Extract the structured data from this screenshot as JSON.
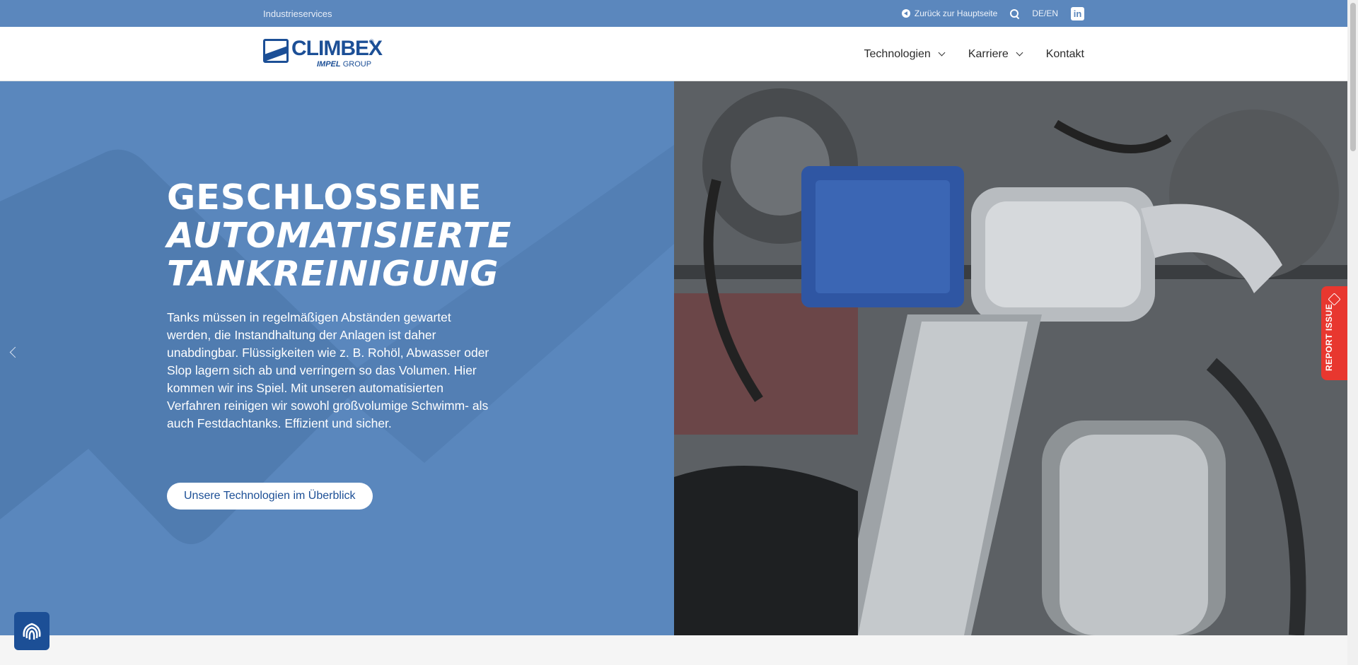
{
  "topbar": {
    "left_link": "Industrieservices",
    "back_link": "Zurück zur Hauptseite",
    "lang": "DE/EN",
    "linkedin": "in"
  },
  "header": {
    "logo": {
      "word": "CLIMBEX",
      "reg": "®",
      "sub_bold": "IMPEL",
      "sub_rest": "GROUP"
    },
    "nav": [
      "Technologien",
      "Karriere",
      "Kontakt"
    ]
  },
  "hero": {
    "title_lines": [
      "GESCHLOSSENE",
      "AUTOMATISIERTE",
      "TANKREINIGUNG"
    ],
    "text": "Tanks müssen in regelmäßigen Abständen gewartet werden, die Instandhaltung der Anlagen ist daher unabdingbar. Flüssigkeiten wie z. B. Rohöl, Abwasser oder Slop lagern sich ab und verringern so das Volumen. Hier kommen wir ins Spiel. Mit unseren automatisierten Verfahren reinigen wir sowohl großvolumige Schwimm- als auch Festdachtanks. Effizient und sicher.",
    "button": "Unsere Technologien im Überblick"
  },
  "report_issue": "REPORT ISSUE",
  "colors": {
    "brand_blue": "#1c4f96",
    "hero_blue": "#5a87bd",
    "report_red": "#e8372f"
  }
}
